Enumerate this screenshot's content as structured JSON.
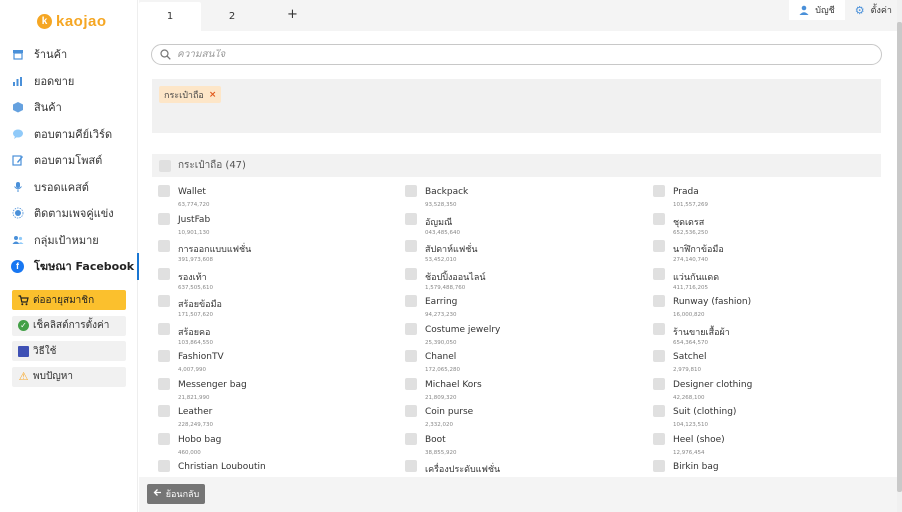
{
  "logo": {
    "text": "kaojao",
    "mark": "k"
  },
  "sidebar": {
    "items": [
      {
        "label": "ร้านค้า",
        "icon": "store-icon"
      },
      {
        "label": "ยอดขาย",
        "icon": "chart-icon"
      },
      {
        "label": "สินค้า",
        "icon": "box-icon"
      },
      {
        "label": "ตอบตามคีย์เวิร์ด",
        "icon": "chat-icon"
      },
      {
        "label": "ตอบตามโพสต์",
        "icon": "edit-icon"
      },
      {
        "label": "บรอดแคสต์",
        "icon": "mic-icon"
      },
      {
        "label": "ติดตามเพจคู่แข่ง",
        "icon": "radar-icon"
      },
      {
        "label": "กลุ่มเป้าหมาย",
        "icon": "users-icon"
      },
      {
        "label": "โฆษณา Facebook",
        "icon": "facebook-icon",
        "active": true
      }
    ],
    "buttons": [
      {
        "label": "ต่ออายุสมาชิก",
        "icon": "cart-icon"
      },
      {
        "label": "เช็คลิสต์การตั้งค่า",
        "icon": "check-icon"
      },
      {
        "label": "วิธีใช้",
        "icon": "book-icon"
      },
      {
        "label": "พบปัญหา",
        "icon": "warning-icon"
      }
    ]
  },
  "tabs": [
    {
      "label": "1"
    },
    {
      "label": "2"
    }
  ],
  "tab_add": "+",
  "account": {
    "label": "บัญชี",
    "settings": "ตั้งค่า"
  },
  "search": {
    "placeholder": "ความสนใจ"
  },
  "selected_chip": {
    "label": "กระเป๋าถือ",
    "close": "×"
  },
  "group_header": "กระเป๋าถือ (47)",
  "columns": [
    [
      {
        "name": "Wallet",
        "count": "63,774,720"
      },
      {
        "name": "JustFab",
        "count": "10,901,130"
      },
      {
        "name": "การออกแบบแฟชั่น",
        "count": "391,973,608"
      },
      {
        "name": "รองเท้า",
        "count": "637,505,610"
      },
      {
        "name": "สร้อยข้อมือ",
        "count": "171,507,620"
      },
      {
        "name": "สร้อยคอ",
        "count": "103,864,550"
      },
      {
        "name": "FashionTV",
        "count": "4,007,990"
      },
      {
        "name": "Messenger bag",
        "count": "21,821,990"
      },
      {
        "name": "Leather",
        "count": "228,249,730"
      },
      {
        "name": "Hobo bag",
        "count": "460,000"
      },
      {
        "name": "Christian Louboutin",
        "count": ""
      }
    ],
    [
      {
        "name": "Backpack",
        "count": "93,528,350"
      },
      {
        "name": "อัญมณี",
        "count": "043,485,640"
      },
      {
        "name": "สัปดาห์แฟชั่น",
        "count": "53,452,010"
      },
      {
        "name": "ช้อปปิ้งออนไลน์",
        "count": "1,579,488,760"
      },
      {
        "name": "Earring",
        "count": "94,273,230"
      },
      {
        "name": "Costume jewelry",
        "count": "25,390,050"
      },
      {
        "name": "Chanel",
        "count": "172,065,280"
      },
      {
        "name": "Michael Kors",
        "count": "21,809,320"
      },
      {
        "name": "Coin purse",
        "count": "2,332,020"
      },
      {
        "name": "Boot",
        "count": "38,855,920"
      },
      {
        "name": "เครื่องประดับแฟชั่น",
        "count": ""
      }
    ],
    [
      {
        "name": "Prada",
        "count": "101,557,269"
      },
      {
        "name": "ชุดเดรส",
        "count": "652,536,250"
      },
      {
        "name": "นาฬิกาข้อมือ",
        "count": "274,140,740"
      },
      {
        "name": "แว่นกันแดด",
        "count": "411,716,205"
      },
      {
        "name": "Runway (fashion)",
        "count": "16,000,820"
      },
      {
        "name": "ร้านขายเสื้อผ้า",
        "count": "654,364,570"
      },
      {
        "name": "Satchel",
        "count": "2,979,810"
      },
      {
        "name": "Designer clothing",
        "count": "42,268,100"
      },
      {
        "name": "Suit (clothing)",
        "count": "104,123,510"
      },
      {
        "name": "Heel (shoe)",
        "count": "12,976,454"
      },
      {
        "name": "Birkin bag",
        "count": ""
      }
    ]
  ],
  "footer": {
    "back_label": "ย้อนกลับ"
  },
  "colors": {
    "accent": "#1976d2",
    "yellow": "#fbc02d",
    "chip": "#fde6c8",
    "logo": "#f5a623"
  }
}
